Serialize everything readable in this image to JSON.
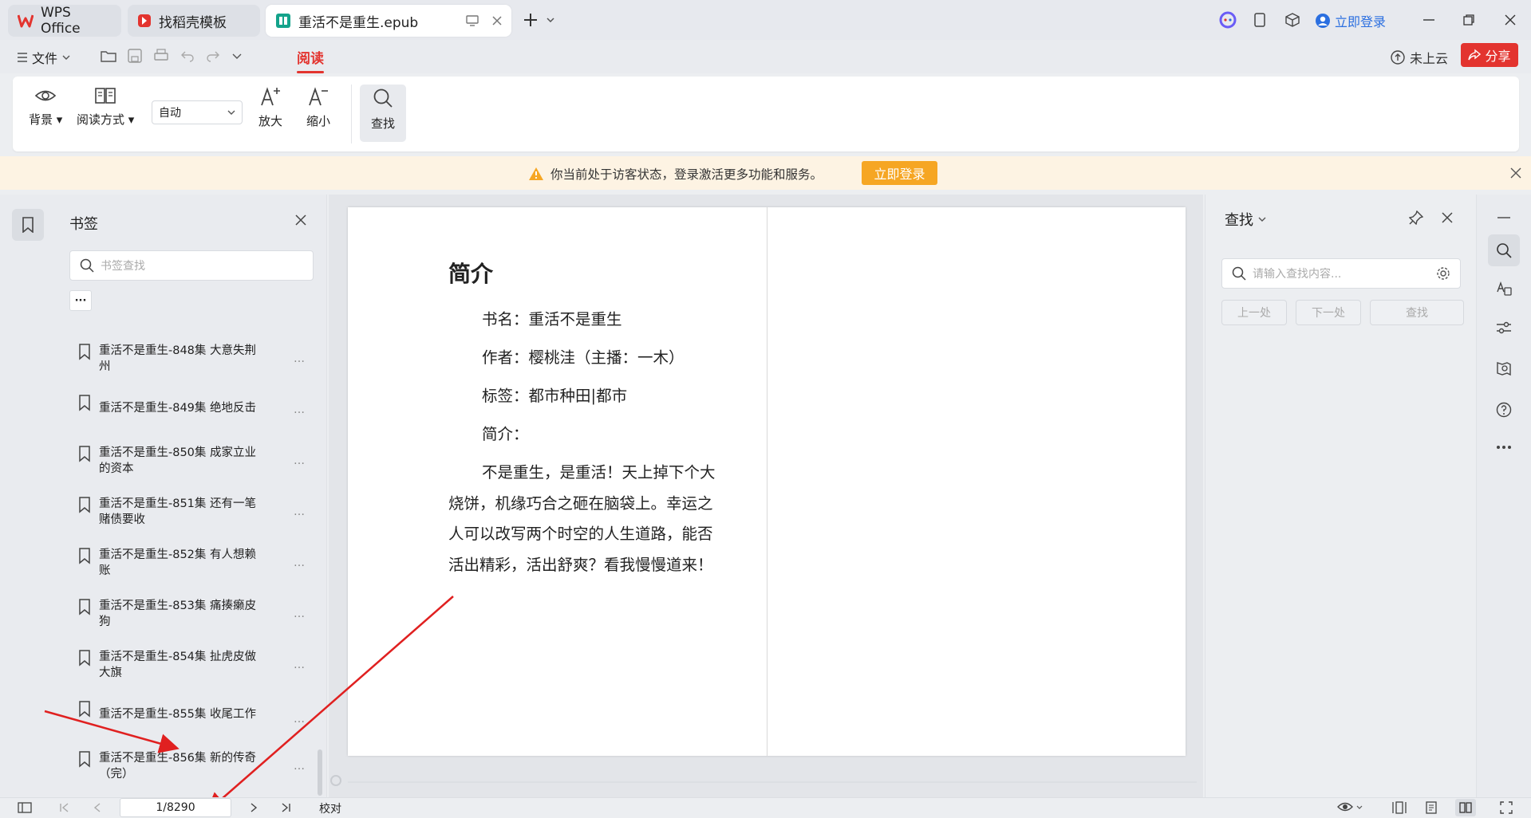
{
  "tabs": [
    {
      "label": "WPS Office"
    },
    {
      "label": "找稻壳模板"
    },
    {
      "label": "重活不是重生.epub"
    }
  ],
  "titlebar": {
    "login_label": "立即登录"
  },
  "menubar": {
    "file_label": "文件",
    "read_tab": "阅读",
    "cloud_label": "未上云",
    "share_label": "分享"
  },
  "ribbon": {
    "background_label": "背景",
    "read_mode_label": "阅读方式",
    "zoom_select": "自动",
    "zoom_in_label": "放大",
    "zoom_out_label": "缩小",
    "find_label": "查找"
  },
  "banner": {
    "message": "你当前处于访客状态，登录激活更多功能和服务。",
    "login_button": "立即登录"
  },
  "bookmarks": {
    "title": "书签",
    "search_placeholder": "书签查找",
    "more_label": "···",
    "items": [
      {
        "label": "重活不是重生-848集 大意失荆州"
      },
      {
        "label": "重活不是重生-849集 绝地反击"
      },
      {
        "label": "重活不是重生-850集 成家立业的资本"
      },
      {
        "label": "重活不是重生-851集 还有一笔赌债要收"
      },
      {
        "label": "重活不是重生-852集 有人想赖账"
      },
      {
        "label": "重活不是重生-853集 痛揍癞皮狗"
      },
      {
        "label": "重活不是重生-854集 扯虎皮做大旗"
      },
      {
        "label": "重活不是重生-855集 收尾工作"
      },
      {
        "label": "重活不是重生-856集 新的传奇（完）"
      }
    ]
  },
  "document": {
    "heading": "简介",
    "lines": [
      "书名：重活不是重生",
      "作者：樱桃洼（主播：一木）",
      "标签：都市种田|都市",
      "简介："
    ],
    "paragraph": "不是重生，是重活！天上掉下个大烧饼，机缘巧合之砸在脑袋上。幸运之人可以改写两个时空的人生道路，能否活出精彩，活出舒爽？看我慢慢道来！"
  },
  "find": {
    "title": "查找",
    "placeholder": "请输入查找内容...",
    "prev_label": "上一处",
    "next_label": "下一处",
    "find_label": "查找"
  },
  "status": {
    "page": "1/8290",
    "proof_label": "校对"
  },
  "colors": {
    "accent_red": "#e3342f",
    "login_orange": "#f6a623",
    "link_blue": "#2b6fe0",
    "annotation_red": "#e02020"
  },
  "icons": [
    "wps-logo-icon",
    "docer-icon",
    "epub-icon",
    "search-icon",
    "bookmark-icon",
    "eye-icon",
    "book-icon",
    "warning-icon"
  ]
}
